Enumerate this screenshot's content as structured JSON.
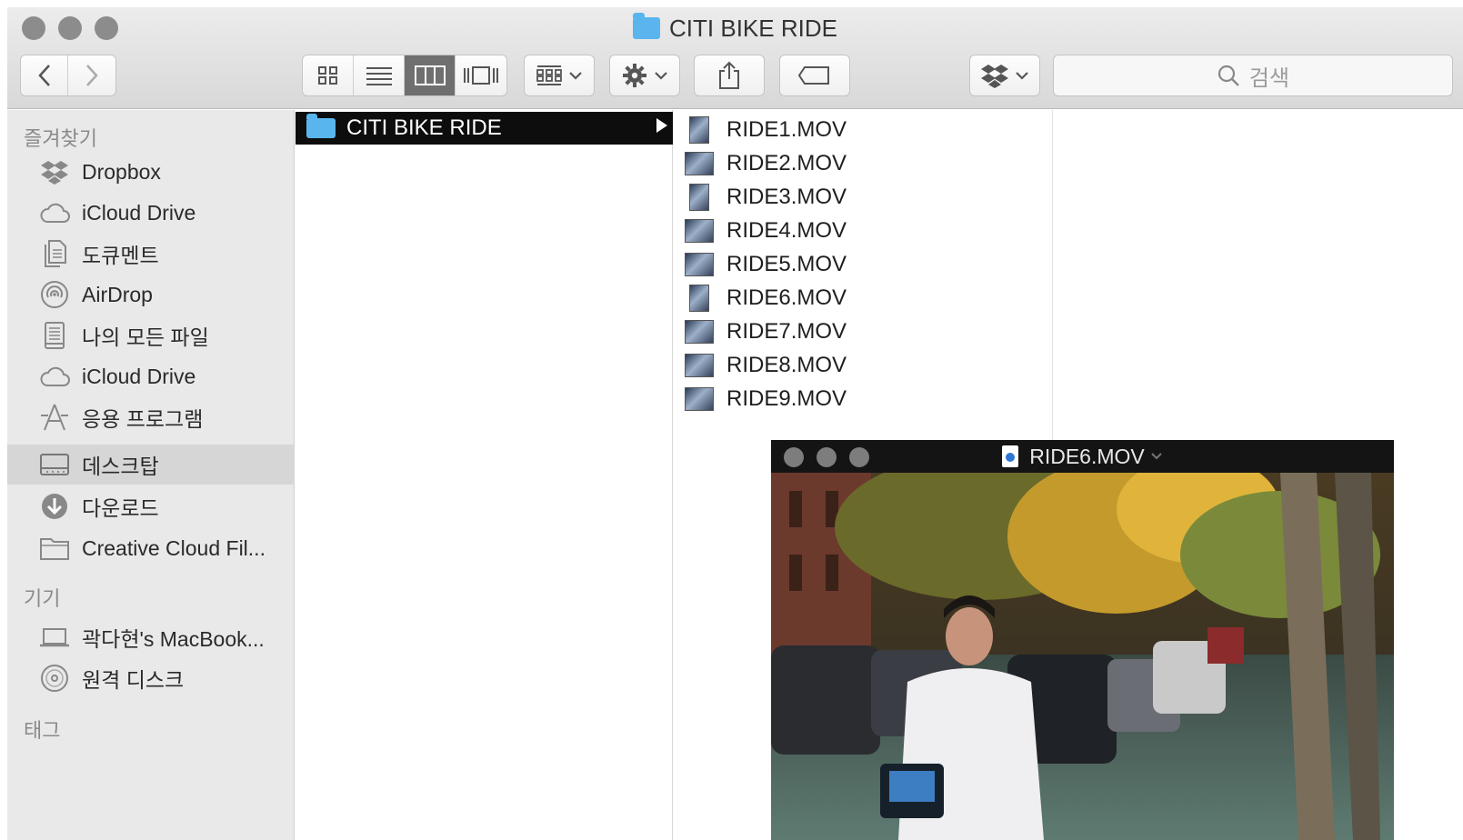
{
  "window": {
    "title": "CITI BIKE RIDE",
    "title_icon": "folder-icon"
  },
  "toolbar": {
    "back_icon": "chevron-left-icon",
    "forward_icon": "chevron-right-icon",
    "view_modes": [
      "icon-view-icon",
      "list-view-icon",
      "column-view-icon",
      "cover-flow-icon"
    ],
    "active_view": "column-view-icon",
    "arrange_icon": "arrange-grid-icon",
    "action_icon": "gear-icon",
    "share_icon": "share-icon",
    "tag_icon": "tag-icon",
    "dropbox_icon": "dropbox-icon",
    "search_placeholder": "검색"
  },
  "sidebar": {
    "favorites_header": "즐겨찾기",
    "favorites": [
      {
        "label": "Dropbox",
        "icon": "dropbox-icon"
      },
      {
        "label": "iCloud Drive",
        "icon": "cloud-icon"
      },
      {
        "label": "도큐멘트",
        "icon": "documents-icon"
      },
      {
        "label": "AirDrop",
        "icon": "airdrop-icon"
      },
      {
        "label": "나의 모든 파일",
        "icon": "all-files-icon"
      },
      {
        "label": "iCloud Drive",
        "icon": "cloud-icon"
      },
      {
        "label": "응용 프로그램",
        "icon": "applications-icon"
      },
      {
        "label": "데스크탑",
        "icon": "desktop-icon",
        "selected": true
      },
      {
        "label": "다운로드",
        "icon": "downloads-icon"
      },
      {
        "label": "Creative Cloud Fil...",
        "icon": "folder-icon"
      }
    ],
    "devices_header": "기기",
    "devices": [
      {
        "label": "곽다현's MacBook...",
        "icon": "laptop-icon"
      },
      {
        "label": "원격 디스크",
        "icon": "disc-icon"
      }
    ],
    "tags_header": "태그"
  },
  "column1": {
    "selected_folder": "CITI BIKE RIDE"
  },
  "column2": {
    "files": [
      "RIDE1.MOV",
      "RIDE2.MOV",
      "RIDE3.MOV",
      "RIDE4.MOV",
      "RIDE5.MOV",
      "RIDE6.MOV",
      "RIDE7.MOV",
      "RIDE8.MOV",
      "RIDE9.MOV"
    ]
  },
  "player": {
    "title": "RIDE6.MOV"
  },
  "colors": {
    "folder_blue": "#5ab5ee",
    "selection_black": "#0d0d0d",
    "sidebar_bg": "#e9e9e9",
    "sidebar_selected": "#d6d6d6"
  }
}
